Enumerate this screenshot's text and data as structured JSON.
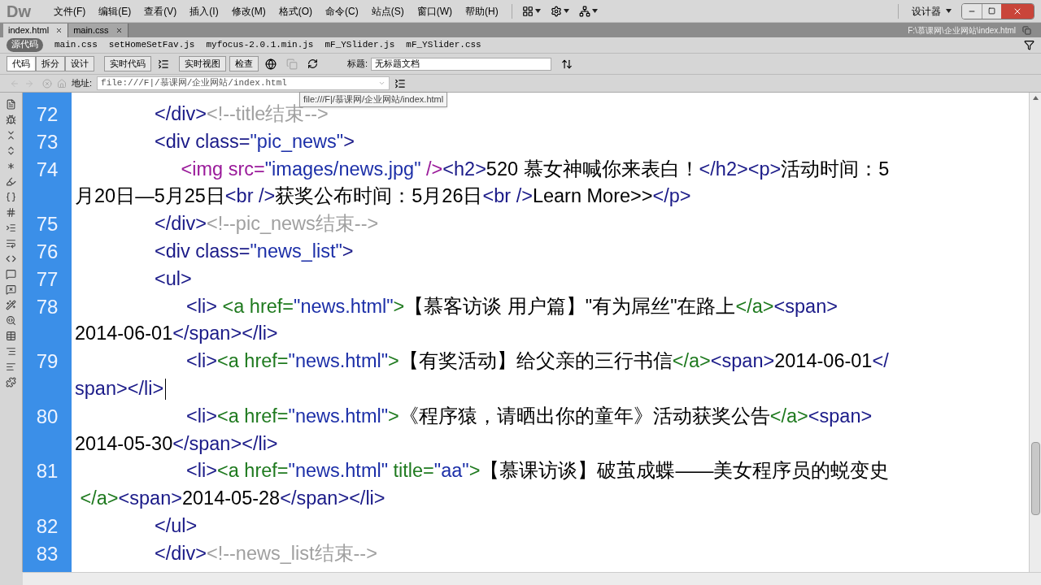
{
  "menu_bar": {
    "logo": "Dw",
    "items": [
      "文件(F)",
      "编辑(E)",
      "查看(V)",
      "插入(I)",
      "修改(M)",
      "格式(O)",
      "命令(C)",
      "站点(S)",
      "窗口(W)",
      "帮助(H)"
    ],
    "workspace": "设计器"
  },
  "document_tabs": [
    {
      "label": "index.html",
      "selected": true
    },
    {
      "label": "main.css",
      "selected": false
    }
  ],
  "file_path": "F:\\慕课网\\企业网站\\index.html",
  "related_files": [
    {
      "label": "源代码",
      "selected": true
    },
    {
      "label": "main.css",
      "selected": false
    },
    {
      "label": "setHomeSetFav.js",
      "selected": false
    },
    {
      "label": "myfocus-2.0.1.min.js",
      "selected": false
    },
    {
      "label": "mF_YSlider.js",
      "selected": false
    },
    {
      "label": "mF_YSlider.css",
      "selected": false
    }
  ],
  "view_buttons": [
    {
      "label": "代码",
      "selected": true
    },
    {
      "label": "拆分",
      "selected": false
    },
    {
      "label": "设计",
      "selected": false
    }
  ],
  "live_code": "实时代码",
  "live_view": "实时视图",
  "inspect": "检查",
  "title_field": {
    "label": "标题:",
    "value": "无标题文档"
  },
  "address_bar": {
    "label": "地址:",
    "value": "file:///F|/慕课网/企业网站/index.html"
  },
  "tooltip": "file:///F|/慕课网/企业网站/index.html",
  "code_lines": [
    {
      "number": "72",
      "caret": false,
      "rows": [
        {
          "segments": [
            {
              "kind": "tag",
              "text": "               </div>"
            },
            {
              "kind": "comment",
              "text": "<!--title结束-->"
            }
          ]
        }
      ]
    },
    {
      "number": "73",
      "caret": false,
      "rows": [
        {
          "segments": [
            {
              "kind": "tag",
              "text": "               <div class="
            },
            {
              "kind": "string",
              "text": "\"pic_news\""
            },
            {
              "kind": "tag",
              "text": ">"
            }
          ]
        }
      ]
    },
    {
      "number": "74",
      "caret": false,
      "rows": [
        {
          "segments": [
            {
              "kind": "img",
              "text": "                    <img src="
            },
            {
              "kind": "string",
              "text": "\"images/news.jpg\""
            },
            {
              "kind": "img",
              "text": " />"
            },
            {
              "kind": "tag",
              "text": "<h2>"
            },
            {
              "kind": "text",
              "text": "520 慕女神喊你来表白！"
            },
            {
              "kind": "tag",
              "text": "</h2><p>"
            },
            {
              "kind": "text",
              "text": "活动时间：5"
            }
          ]
        },
        {
          "segments": [
            {
              "kind": "text",
              "text": "月20日—5月25日"
            },
            {
              "kind": "tag",
              "text": "<br />"
            },
            {
              "kind": "text",
              "text": "获奖公布时间：5月26日"
            },
            {
              "kind": "tag",
              "text": "<br />"
            },
            {
              "kind": "text",
              "text": "Learn More>>"
            },
            {
              "kind": "tag",
              "text": "</p>"
            }
          ]
        }
      ]
    },
    {
      "number": "75",
      "caret": false,
      "rows": [
        {
          "segments": [
            {
              "kind": "tag",
              "text": "               </div>"
            },
            {
              "kind": "comment",
              "text": "<!--pic_news结束-->"
            }
          ]
        }
      ]
    },
    {
      "number": "76",
      "caret": false,
      "rows": [
        {
          "segments": [
            {
              "kind": "tag",
              "text": "               <div class="
            },
            {
              "kind": "string",
              "text": "\"news_list\""
            },
            {
              "kind": "tag",
              "text": ">"
            }
          ]
        }
      ]
    },
    {
      "number": "77",
      "caret": false,
      "rows": [
        {
          "segments": [
            {
              "kind": "tag",
              "text": "               <ul>"
            }
          ]
        }
      ]
    },
    {
      "number": "78",
      "caret": false,
      "rows": [
        {
          "segments": [
            {
              "kind": "tag",
              "text": "                     <li> "
            },
            {
              "kind": "link",
              "text": "<a href="
            },
            {
              "kind": "string",
              "text": "\"news.html\""
            },
            {
              "kind": "link",
              "text": ">"
            },
            {
              "kind": "text",
              "text": "【慕客访谈 用户篇】\"有为屌丝\"在路上"
            },
            {
              "kind": "link",
              "text": "</a>"
            },
            {
              "kind": "tag",
              "text": "<span>"
            }
          ]
        },
        {
          "segments": [
            {
              "kind": "text",
              "text": "2014-06-01"
            },
            {
              "kind": "tag",
              "text": "</span></li>"
            }
          ]
        }
      ]
    },
    {
      "number": "79",
      "caret": true,
      "rows": [
        {
          "segments": [
            {
              "kind": "tag",
              "text": "                     <li>"
            },
            {
              "kind": "link",
              "text": "<a href="
            },
            {
              "kind": "string",
              "text": "\"news.html\""
            },
            {
              "kind": "link",
              "text": ">"
            },
            {
              "kind": "text",
              "text": "【有奖活动】给父亲的三行书信"
            },
            {
              "kind": "link",
              "text": "</a>"
            },
            {
              "kind": "tag",
              "text": "<span>"
            },
            {
              "kind": "text",
              "text": "2014-06-01"
            },
            {
              "kind": "tag",
              "text": "</"
            }
          ]
        },
        {
          "segments": [
            {
              "kind": "tag",
              "text": "span></li>"
            }
          ]
        }
      ]
    },
    {
      "number": "80",
      "caret": false,
      "rows": [
        {
          "segments": [
            {
              "kind": "tag",
              "text": "                     <li>"
            },
            {
              "kind": "link",
              "text": "<a href="
            },
            {
              "kind": "string",
              "text": "\"news.html\""
            },
            {
              "kind": "link",
              "text": ">"
            },
            {
              "kind": "text",
              "text": "《程序猿，请晒出你的童年》活动获奖公告"
            },
            {
              "kind": "link",
              "text": "</a>"
            },
            {
              "kind": "tag",
              "text": "<span>"
            }
          ]
        },
        {
          "segments": [
            {
              "kind": "text",
              "text": "2014-05-30"
            },
            {
              "kind": "tag",
              "text": "</span></li>"
            }
          ]
        }
      ]
    },
    {
      "number": "81",
      "caret": false,
      "rows": [
        {
          "segments": [
            {
              "kind": "tag",
              "text": "                     <li>"
            },
            {
              "kind": "link",
              "text": "<a href="
            },
            {
              "kind": "string",
              "text": "\"news.html\""
            },
            {
              "kind": "link",
              "text": " title="
            },
            {
              "kind": "string",
              "text": "\"aa\""
            },
            {
              "kind": "link",
              "text": ">"
            },
            {
              "kind": "text",
              "text": "【慕课访谈】破茧成蝶——美女程序员的蜕变史"
            }
          ]
        },
        {
          "segments": [
            {
              "kind": "link",
              "text": " </a>"
            },
            {
              "kind": "tag",
              "text": "<span>"
            },
            {
              "kind": "text",
              "text": "2014-05-28"
            },
            {
              "kind": "tag",
              "text": "</span></li>"
            }
          ]
        }
      ]
    },
    {
      "number": "82",
      "caret": false,
      "rows": [
        {
          "segments": [
            {
              "kind": "tag",
              "text": "               </ul>"
            }
          ]
        }
      ]
    },
    {
      "number": "83",
      "caret": false,
      "rows": [
        {
          "segments": [
            {
              "kind": "tag",
              "text": "               </div>"
            },
            {
              "kind": "comment",
              "text": "<!--news_list结束-->"
            }
          ]
        }
      ]
    }
  ]
}
